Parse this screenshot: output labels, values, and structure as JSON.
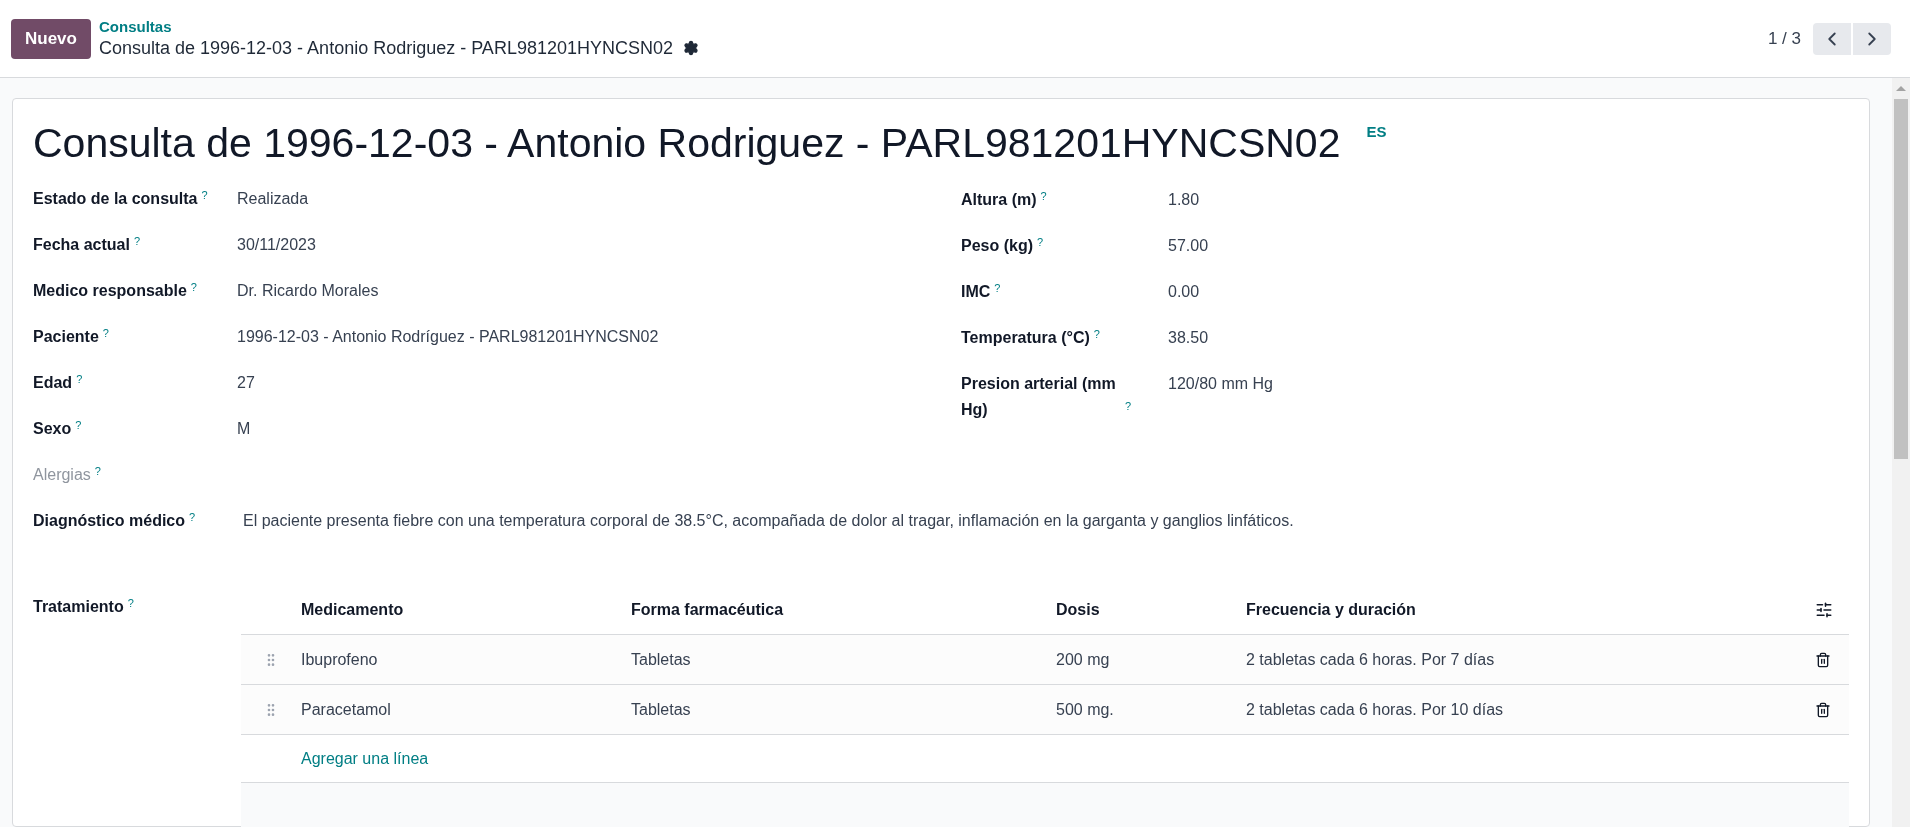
{
  "control_panel": {
    "new_button": "Nuevo",
    "breadcrumb": "Consultas",
    "record_title": "Consulta de 1996-12-03 - Antonio Rodriguez - PARL981201HYNCSN02",
    "pager": "1 / 3"
  },
  "form": {
    "title": "Consulta de 1996-12-03 - Antonio Rodriguez - PARL981201HYNCSN02",
    "language": "ES",
    "left_fields": [
      {
        "label": "Estado de la consulta",
        "help": "?",
        "value": "Realizada",
        "readonly": false
      },
      {
        "label": "Fecha actual",
        "help": "?",
        "value": "30/11/2023",
        "readonly": false
      },
      {
        "label": "Medico responsable",
        "help": "?",
        "value": "Dr. Ricardo Morales",
        "readonly": false
      },
      {
        "label": "Paciente",
        "help": "?",
        "value": "1996-12-03 - Antonio Rodríguez - PARL981201HYNCSN02",
        "readonly": false
      },
      {
        "label": "Edad",
        "help": "?",
        "value": "27",
        "readonly": false
      },
      {
        "label": "Sexo",
        "help": "?",
        "value": "M",
        "readonly": false
      },
      {
        "label": "Alergias",
        "help": "?",
        "readonly": true
      }
    ],
    "right_fields": [
      {
        "label": "Altura (m)",
        "help": "?",
        "value": "1.80"
      },
      {
        "label": "Peso (kg)",
        "help": "?",
        "value": "57.00"
      },
      {
        "label": "IMC",
        "help": "?",
        "value": "0.00"
      },
      {
        "label": "Temperatura (°C)",
        "help": "?",
        "value": "38.50"
      },
      {
        "label": "Presion arterial (mm Hg)",
        "help": "?",
        "value": "120/80 mm Hg"
      }
    ],
    "diagnosis": {
      "label": "Diagnóstico médico",
      "help": "?",
      "value": "El paciente presenta fiebre con una temperatura corporal de 38.5°C, acompañada de dolor al tragar, inflamación en la garganta y ganglios linfáticos."
    },
    "treatment": {
      "label": "Tratamiento",
      "help": "?",
      "columns": [
        "Medicamento",
        "Forma farmacéutica",
        "Dosis",
        "Frecuencia y duración"
      ],
      "rows": [
        [
          "Ibuprofeno",
          "Tabletas",
          "200 mg",
          "2 tabletas cada 6 horas. Por 7 días"
        ],
        [
          "Paracetamol",
          "Tabletas",
          "500 mg.",
          "2 tabletas cada 6 horas. Por 10 días"
        ]
      ],
      "add_line": "Agregar una línea"
    }
  }
}
